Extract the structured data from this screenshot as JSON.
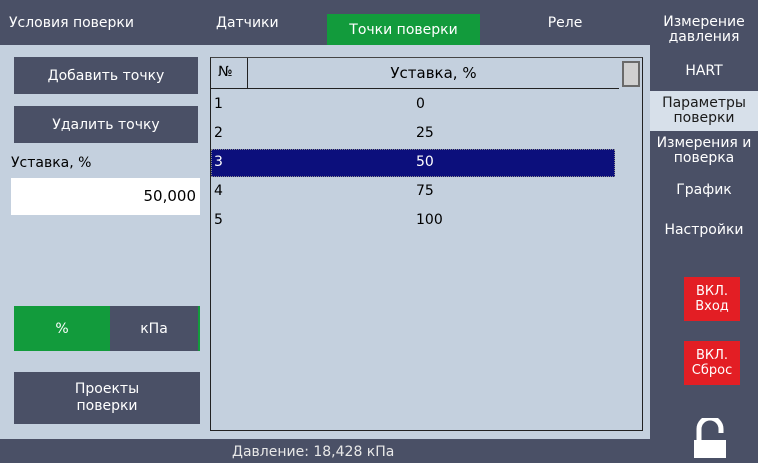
{
  "tabs": [
    {
      "label": "Условия поверки"
    },
    {
      "label": "Датчики"
    },
    {
      "label": "Точки поверки"
    },
    {
      "label": "Реле"
    }
  ],
  "left_panel": {
    "add_point": "Добавить точку",
    "delete_point": "Удалить точку",
    "setpoint_label": "Уставка, %",
    "setpoint_value": "50,000",
    "unit_percent": "%",
    "unit_kpa": "кПа",
    "projects_line1": "Проекты",
    "projects_line2": "поверки"
  },
  "table": {
    "col_num": "№",
    "col_setpoint": "Уставка, %",
    "rows": [
      {
        "num": "1",
        "value": "0"
      },
      {
        "num": "2",
        "value": "25"
      },
      {
        "num": "3",
        "value": "50"
      },
      {
        "num": "4",
        "value": "75"
      },
      {
        "num": "5",
        "value": "100"
      }
    ],
    "selected_index": 2
  },
  "right_menu": {
    "pressure_1": "Измерение",
    "pressure_2": "давления",
    "hart": "HART",
    "params_1": "Параметры",
    "params_2": "поверки",
    "meas_1": "Измерения и",
    "meas_2": "поверка",
    "graph": "График",
    "settings": "Настройки",
    "input_1": "ВКЛ.",
    "input_2": "Вход",
    "reset_1": "ВКЛ.",
    "reset_2": "Сброс"
  },
  "status": {
    "pressure": "Давление: 18,428 кПа"
  },
  "colors": {
    "accent_green": "#129b3c",
    "selection_navy": "#0c0f7c",
    "alert_red": "#e31e24",
    "panel": "#4a5066",
    "content_bg": "#c4d0de"
  }
}
